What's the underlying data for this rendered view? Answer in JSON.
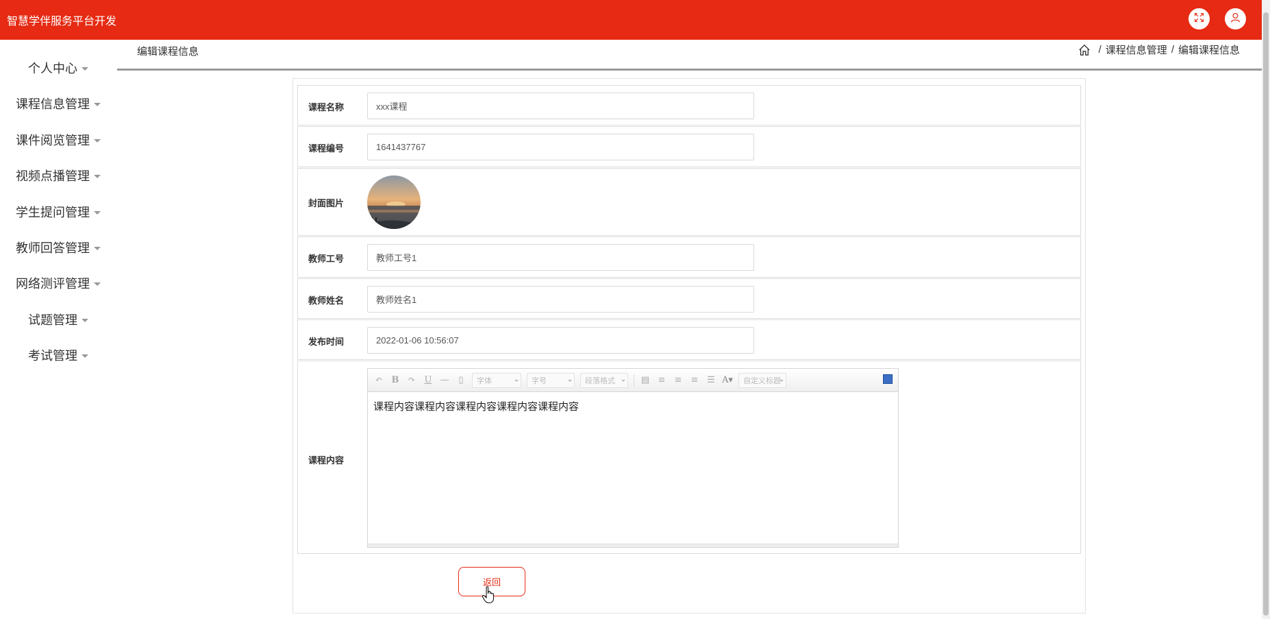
{
  "header": {
    "app_title": "智慧学伴服务平台开发",
    "fullscreen_icon": "expand-icon",
    "user_icon": "user-icon"
  },
  "colors": {
    "primary": "#e62a13",
    "header_text": "#ffffff"
  },
  "sidebar": {
    "items": [
      {
        "label": "个人中心"
      },
      {
        "label": "课程信息管理"
      },
      {
        "label": "课件阅览管理"
      },
      {
        "label": "视频点播管理"
      },
      {
        "label": "学生提问管理"
      },
      {
        "label": "教师回答管理"
      },
      {
        "label": "网络测评管理"
      },
      {
        "label": "试题管理"
      },
      {
        "label": "考试管理"
      }
    ]
  },
  "page": {
    "title": "编辑课程信息",
    "breadcrumb": [
      "课程信息管理",
      "编辑课程信息"
    ]
  },
  "form": {
    "course_name": {
      "label": "课程名称",
      "value": "xxx课程"
    },
    "course_code": {
      "label": "课程编号",
      "value": "1641437767"
    },
    "cover": {
      "label": "封面图片",
      "icon": "cover-image"
    },
    "teacher_id": {
      "label": "教师工号",
      "value": "教师工号1"
    },
    "teacher_name": {
      "label": "教师姓名",
      "value": "教师姓名1"
    },
    "publish_time": {
      "label": "发布时间",
      "value": "2022-01-06 10:56:07"
    },
    "content": {
      "label": "课程内容",
      "value": "课程内容课程内容课程内容课程内容课程内容",
      "toolbar": {
        "font": "字体",
        "size": "字号",
        "paragraph": "段落格式",
        "custom_title": "自定义标题"
      }
    },
    "back_label": "返回"
  }
}
